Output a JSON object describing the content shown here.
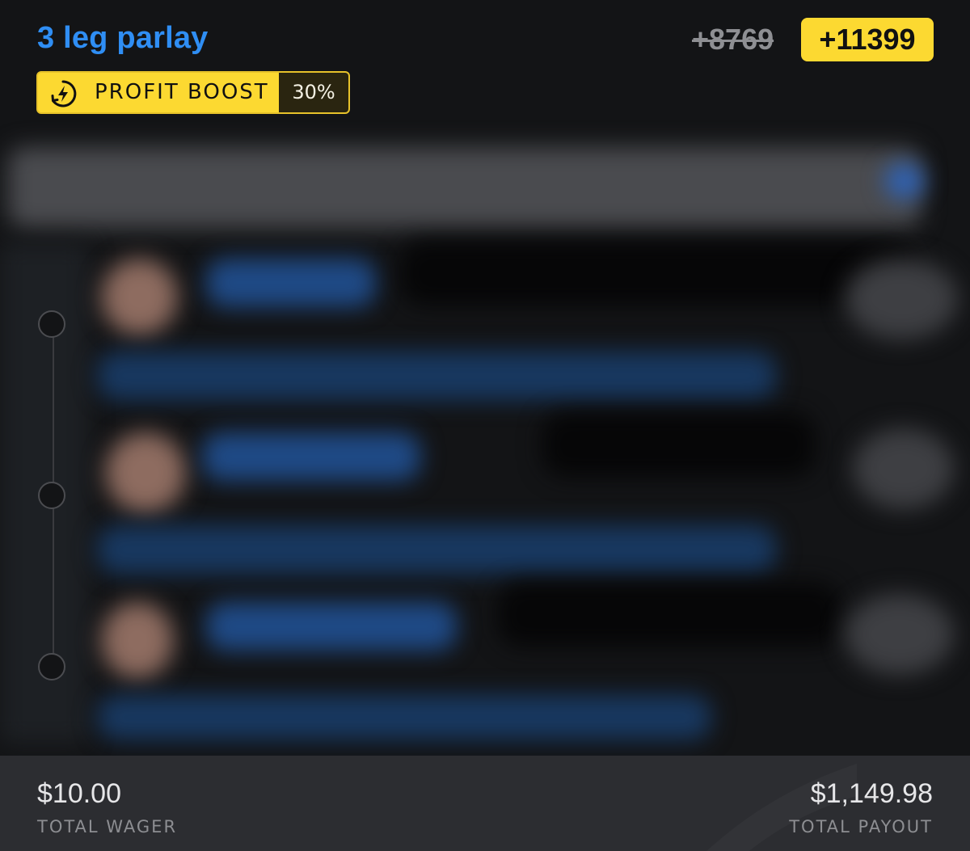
{
  "bet": {
    "title": "3 leg parlay",
    "original_odds": "+8769",
    "boosted_odds": "+11399"
  },
  "boost": {
    "icon": "lightning-bolt-icon",
    "label": "PROFIT BOOST",
    "percent": "30%"
  },
  "legs": {
    "count": 3,
    "content_redacted": true
  },
  "footer": {
    "wager_amount": "$10.00",
    "wager_label": "TOTAL WAGER",
    "payout_amount": "$1,149.98",
    "payout_label": "TOTAL PAYOUT"
  },
  "colors": {
    "title_blue": "#2f8ef4",
    "boost_yellow": "#fcd931",
    "background": "#131416",
    "footer_bg": "#2c2d31",
    "muted_text": "#8d8e92"
  }
}
